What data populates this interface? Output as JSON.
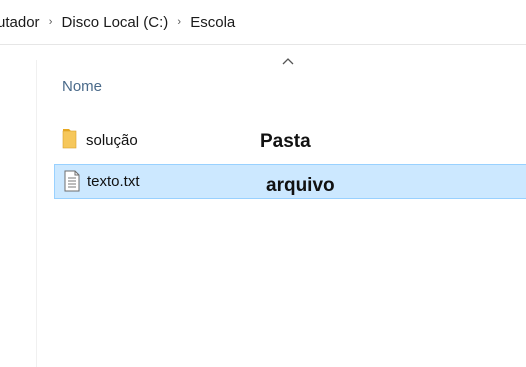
{
  "breadcrumb": {
    "items": [
      {
        "label": "utador"
      },
      {
        "label": "Disco Local (C:)"
      },
      {
        "label": "Escola"
      }
    ],
    "separator": "›"
  },
  "columns": {
    "name_header": "Nome",
    "sort_indicator": "^"
  },
  "files": [
    {
      "name": "solução",
      "icon": "folder-icon",
      "selected": false
    },
    {
      "name": "texto.txt",
      "icon": "text-file-icon",
      "selected": true
    }
  ],
  "annotations": {
    "folder_label": "Pasta",
    "file_label": "arquivo"
  },
  "colors": {
    "selection_bg": "#cce8ff",
    "selection_border": "#99d1ff",
    "folder": "#f6c75b"
  }
}
